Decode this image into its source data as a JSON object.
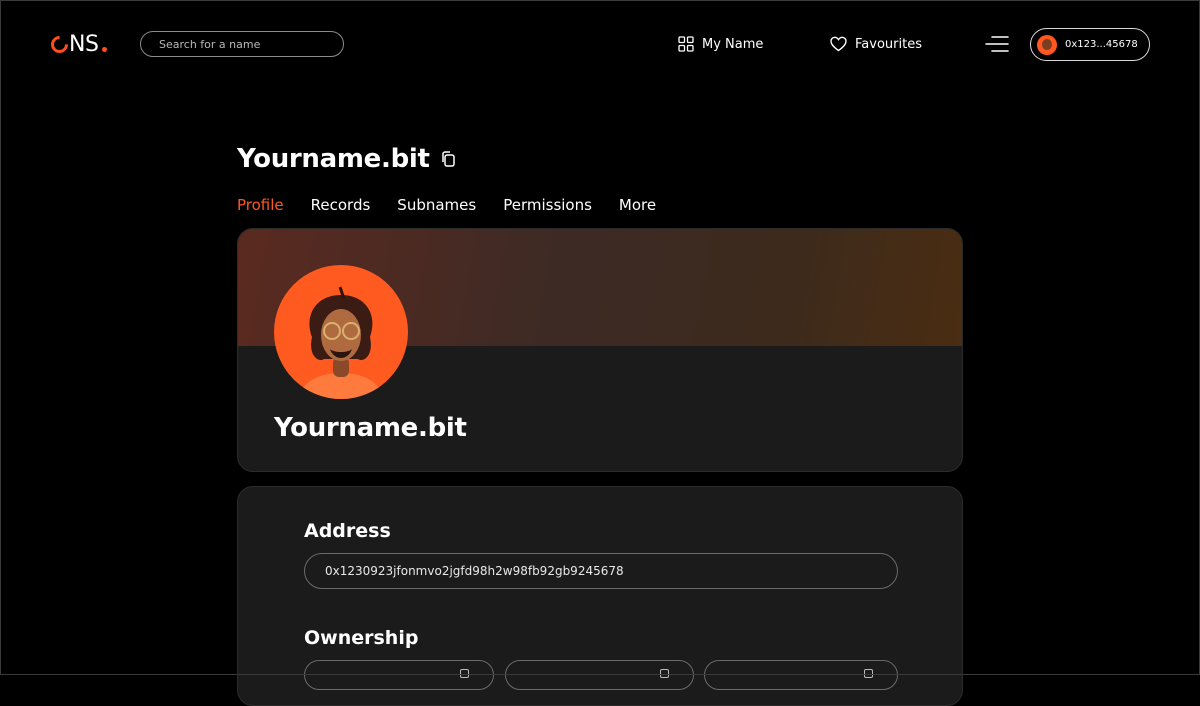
{
  "header": {
    "logo": {
      "text": "NS"
    },
    "search": {
      "placeholder": "Search for a name"
    },
    "nav": [
      {
        "label": "My Name",
        "icon": "grid-icon"
      },
      {
        "label": "Favourites",
        "icon": "heart-icon"
      }
    ],
    "wallet": {
      "address": "0x123...45678"
    }
  },
  "profile": {
    "title": "Yourname.bit",
    "tabs": [
      {
        "label": "Profile",
        "active": true
      },
      {
        "label": "Records",
        "active": false
      },
      {
        "label": "Subnames",
        "active": false
      },
      {
        "label": "Permissions",
        "active": false
      },
      {
        "label": "More",
        "active": false
      }
    ],
    "card_name": "Yourname.bit"
  },
  "details": {
    "address_label": "Address",
    "address_value": "0x1230923jfonmvo2jgfd98h2w98fb92gb9245678",
    "ownership_label": "Ownership"
  },
  "colors": {
    "accent": "#ff5722",
    "background": "#000000",
    "card": "#1b1b1b"
  }
}
